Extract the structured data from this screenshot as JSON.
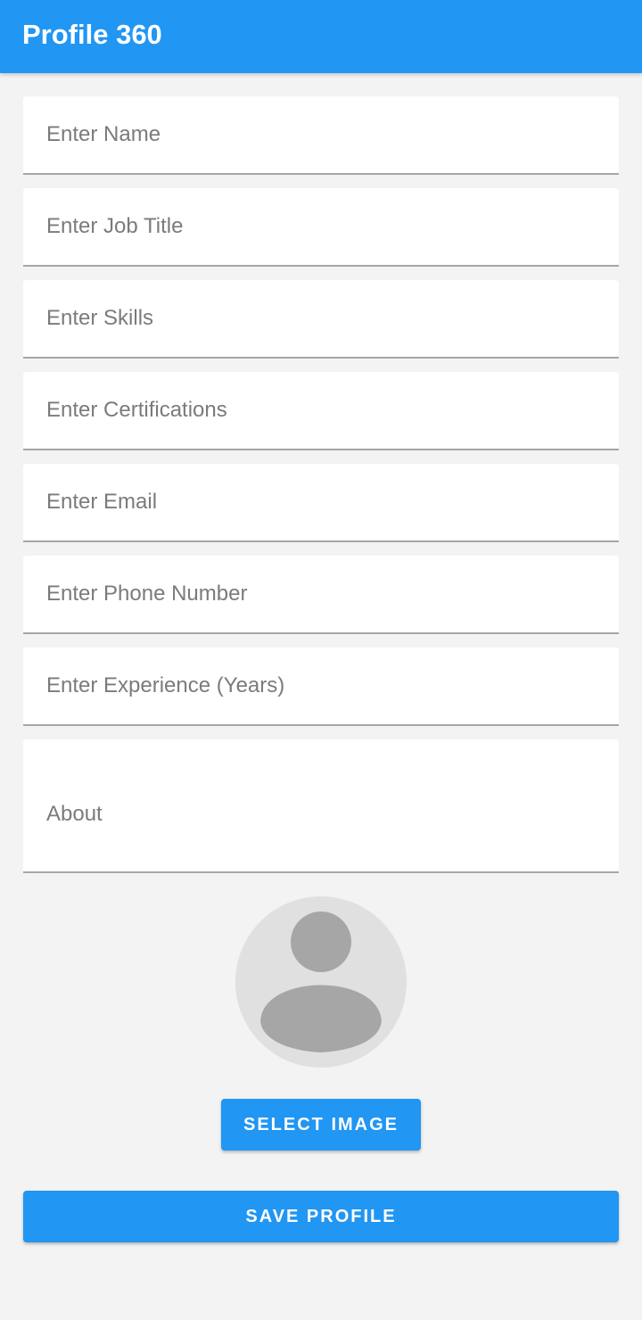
{
  "app": {
    "title": "Profile 360"
  },
  "form": {
    "name_placeholder": "Enter Name",
    "job_title_placeholder": "Enter Job Title",
    "skills_placeholder": "Enter Skills",
    "certifications_placeholder": "Enter Certifications",
    "email_placeholder": "Enter Email",
    "phone_placeholder": "Enter Phone Number",
    "experience_placeholder": "Enter Experience (Years)",
    "about_label": "About"
  },
  "avatar": {
    "icon": "person-placeholder-icon"
  },
  "buttons": {
    "select_image": "SELECT IMAGE",
    "save_profile": "SAVE PROFILE"
  },
  "colors": {
    "primary": "#2196f3",
    "background": "#f3f3f3",
    "field_background": "#ffffff",
    "placeholder_text": "#7b7b7b",
    "avatar_background": "#e0e0e0",
    "avatar_figure": "#a6a6a6"
  }
}
